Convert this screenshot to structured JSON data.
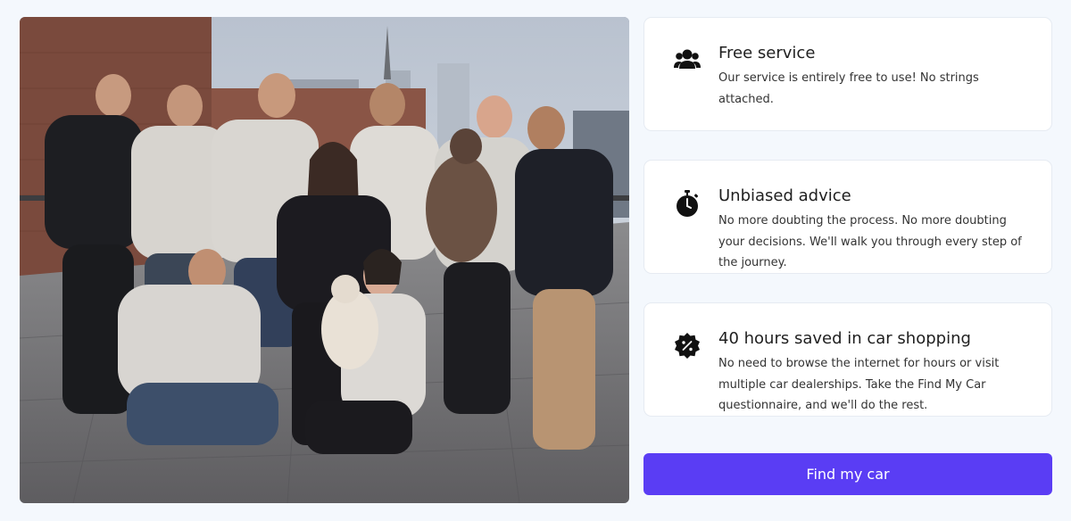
{
  "photo": {
    "alt": "VINN team photo"
  },
  "features": [
    {
      "icon": "users-icon",
      "title": "Free service",
      "text": "Our service is entirely free to use! No strings attached."
    },
    {
      "icon": "stopwatch-icon",
      "title": "Unbiased advice",
      "text": "No more doubting the process. No more doubting your decisions. We'll walk you through every step of the journey."
    },
    {
      "icon": "discount-badge-icon",
      "title": "40 hours saved in car shopping",
      "text": "No need to browse the internet for hours or visit multiple car dealerships. Take the Find My Car questionnaire, and we'll do the rest."
    }
  ],
  "cta": {
    "label": "Find my car"
  },
  "colors": {
    "accent": "#5a3df4",
    "background": "#f4f8fd",
    "card": "#ffffff"
  }
}
